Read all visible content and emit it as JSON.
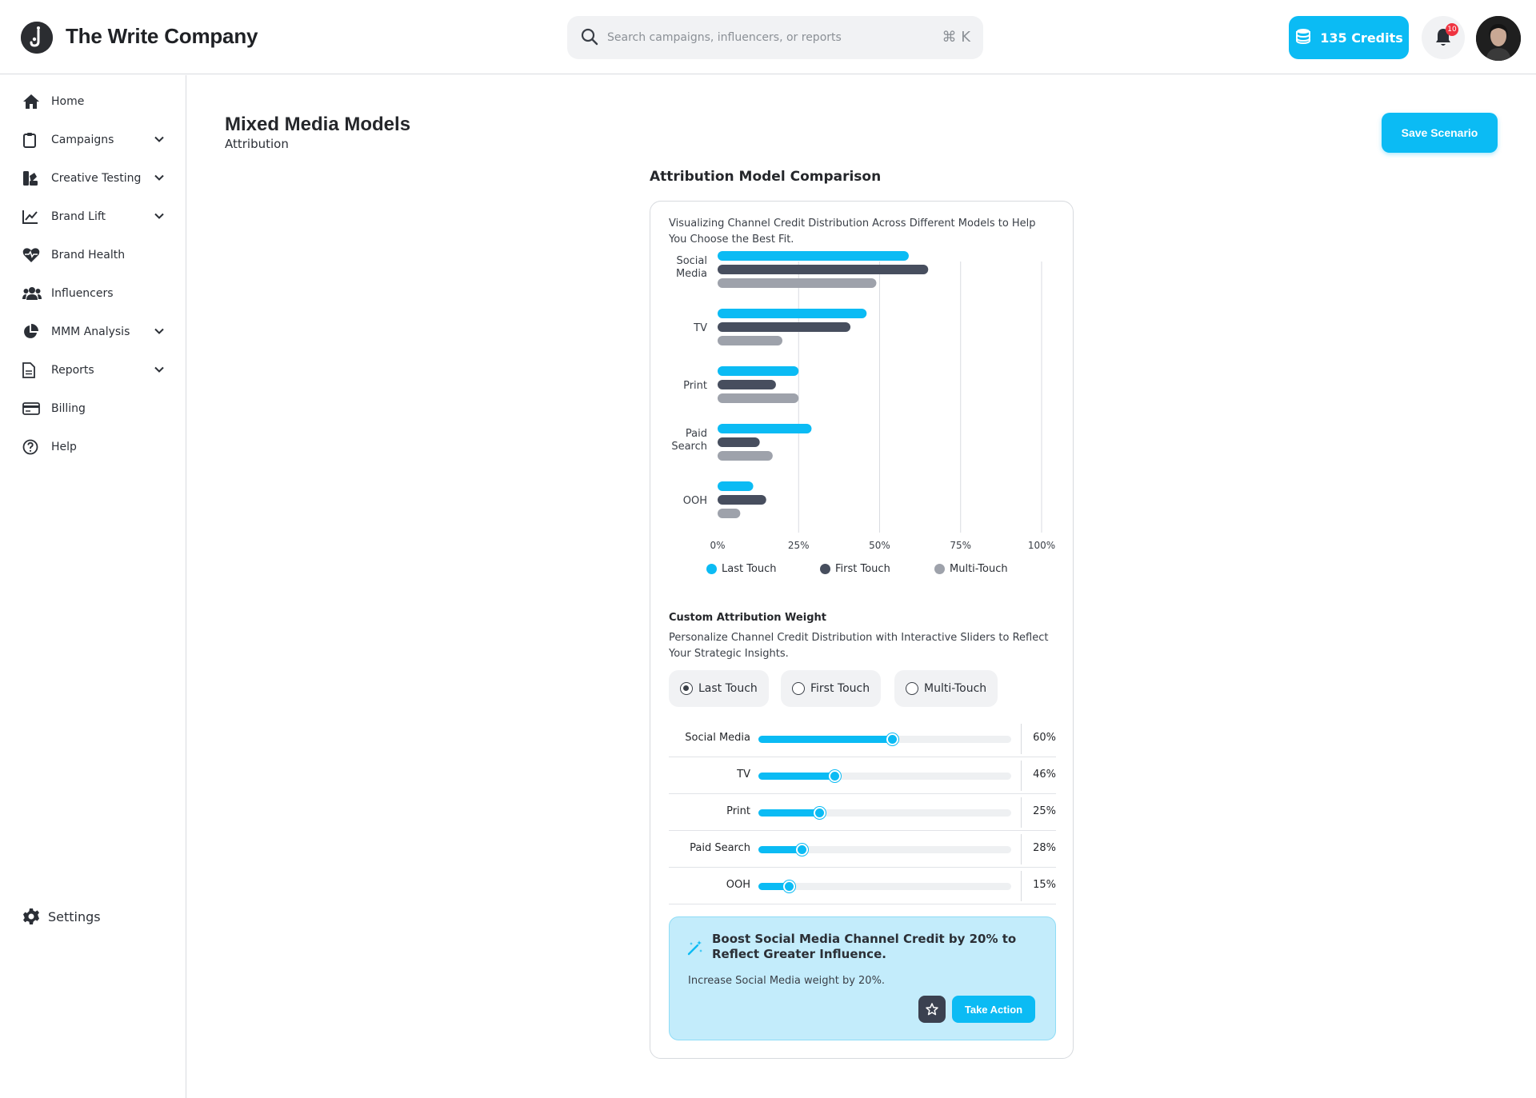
{
  "app": {
    "brand_name": "The Write Company",
    "logo_letter": "j"
  },
  "header": {
    "search": {
      "placeholder": "Search campaigns, influencers, or reports",
      "value": "",
      "shortcut": "⌘ K"
    },
    "credits_label": "135 Credits",
    "notification_count": "10"
  },
  "sidebar": {
    "items": [
      {
        "label": "Home",
        "icon": "home-icon",
        "has_chevron": false
      },
      {
        "label": "Campaigns",
        "icon": "clipboard-icon",
        "has_chevron": true
      },
      {
        "label": "Creative Testing",
        "icon": "swatch-icon",
        "has_chevron": true
      },
      {
        "label": "Brand Lift",
        "icon": "line-chart-icon",
        "has_chevron": true
      },
      {
        "label": "Brand Health",
        "icon": "heart-pulse-icon",
        "has_chevron": false
      },
      {
        "label": "Influencers",
        "icon": "users-icon",
        "has_chevron": false
      },
      {
        "label": "MMM Analysis",
        "icon": "pie-chart-icon",
        "has_chevron": true
      },
      {
        "label": "Reports",
        "icon": "document-icon",
        "has_chevron": true
      },
      {
        "label": "Billing",
        "icon": "credit-card-icon",
        "has_chevron": false
      },
      {
        "label": "Help",
        "icon": "help-circle-icon",
        "has_chevron": false
      }
    ],
    "settings_label": "Settings"
  },
  "page": {
    "title": "Mixed Media Models",
    "subtitle": "Attribution",
    "save_button": "Save Scenario"
  },
  "section": {
    "title": "Attribution Model Comparison",
    "description": "Visualizing Channel Credit Distribution Across Different Models to Help You Choose the Best Fit."
  },
  "chart_data": {
    "type": "bar",
    "orientation": "horizontal",
    "categories": [
      "Social Media",
      "TV",
      "Print",
      "Paid Search",
      "OOH"
    ],
    "series": [
      {
        "name": "Last Touch",
        "color": "#0bbbf4",
        "values": [
          59,
          46,
          25,
          29,
          11
        ]
      },
      {
        "name": "First Touch",
        "color": "#474e5e",
        "values": [
          65,
          41,
          18,
          13,
          15
        ]
      },
      {
        "name": "Multi-Touch",
        "color": "#9ea2ab",
        "values": [
          49,
          20,
          25,
          17,
          7
        ]
      }
    ],
    "xlim": [
      0,
      100
    ],
    "x_ticks": [
      "0%",
      "25%",
      "50%",
      "75%",
      "100%"
    ],
    "x_tick_values": [
      0,
      25,
      50,
      75,
      100
    ],
    "grid": "vertical",
    "legend_position": "bottom"
  },
  "custom_weight": {
    "title": "Custom Attribution Weight",
    "description": "Personalize Channel Credit Distribution with Interactive Sliders to Reflect Your Strategic Insights.",
    "models": [
      {
        "label": "Last Touch",
        "selected": true
      },
      {
        "label": "First Touch",
        "selected": false
      },
      {
        "label": "Multi-Touch",
        "selected": false
      }
    ],
    "sliders": [
      {
        "label": "Social Media",
        "value": 60,
        "value_label": "60%",
        "fill": 0.53
      },
      {
        "label": "TV",
        "value": 46,
        "value_label": "46%",
        "fill": 0.3
      },
      {
        "label": "Print",
        "value": 25,
        "value_label": "25%",
        "fill": 0.24
      },
      {
        "label": "Paid Search",
        "value": 28,
        "value_label": "28%",
        "fill": 0.17
      },
      {
        "label": "OOH",
        "value": 15,
        "value_label": "15%",
        "fill": 0.12
      }
    ]
  },
  "recommendation": {
    "title": "Boost Social Media Channel Credit by 20% to Reflect Greater Influence.",
    "text": "Increase Social Media weight by 20%.",
    "action_label": "Take Action"
  },
  "colors": {
    "accent": "#0bbbf4",
    "dark_series": "#474e5e",
    "light_series": "#9ea2ab",
    "reco_bg": "#c3ecfb"
  }
}
